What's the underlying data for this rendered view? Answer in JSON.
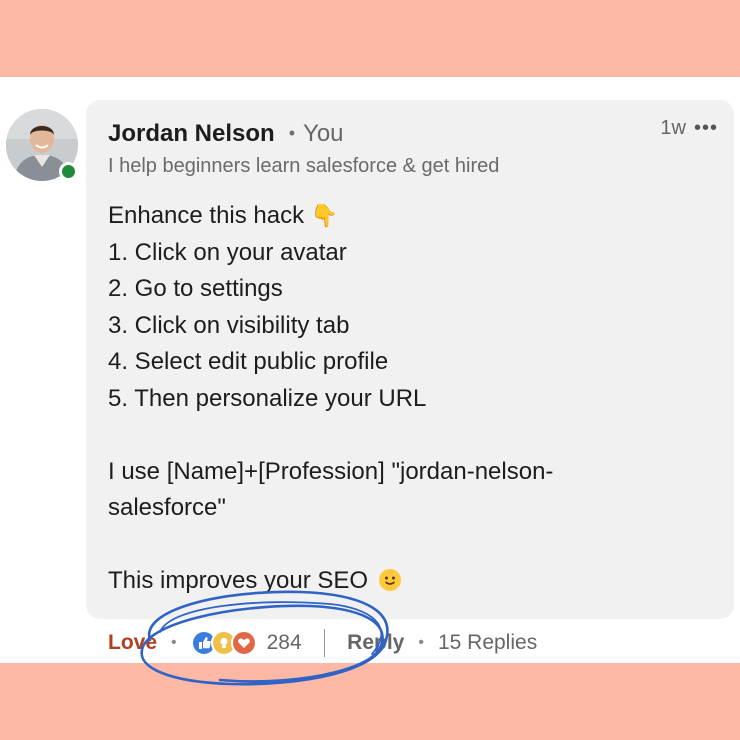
{
  "comment": {
    "author": {
      "name": "Jordan Nelson",
      "relation": "You",
      "headline": "I help beginners learn salesforce & get hired"
    },
    "time": "1w",
    "more_glyph": "•••",
    "body": {
      "lines_1": [
        "Enhance this hack",
        "1. Click on your avatar",
        "2. Go to settings",
        "3. Click on visibility tab",
        "4. Select edit public profile",
        "5. Then personalize your URL"
      ],
      "hand_glyph": "👇",
      "paragraph_2": "I use [Name]+[Profession] \"jordan-nelson-salesforce\"",
      "paragraph_3": "This improves your SEO"
    },
    "actions": {
      "love_label": "Love",
      "reaction_count": "284",
      "reply_label": "Reply",
      "replies_label": "15 Replies"
    },
    "icons": {
      "reactions": [
        "like-icon",
        "insightful-icon",
        "love-icon"
      ],
      "emoji": "smile-icon",
      "presence": "online-dot-icon"
    },
    "colors": {
      "band": "#FDB8A6",
      "bubble": "#f1f1f2",
      "love": "#b24020",
      "online": "#1f8a3a",
      "scribble": "#2f63c6"
    }
  }
}
